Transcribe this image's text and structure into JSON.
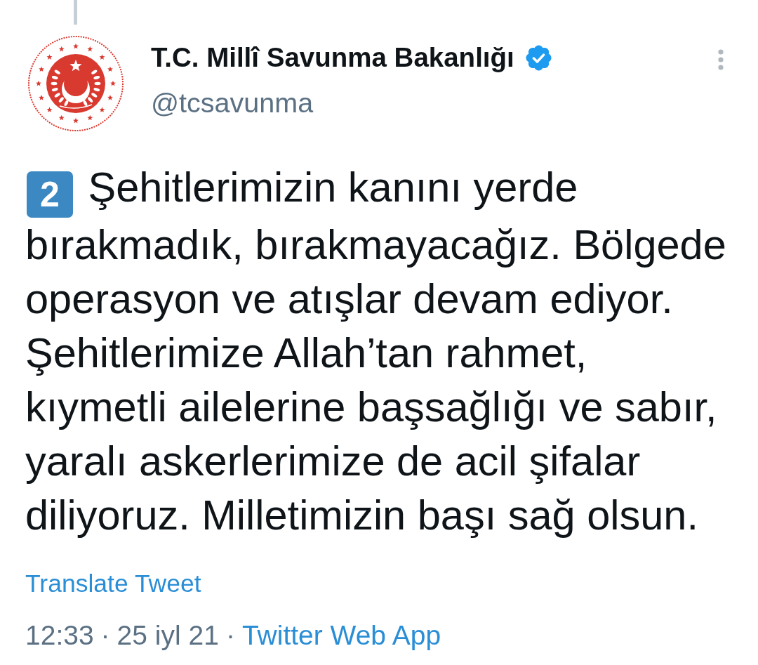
{
  "author": {
    "name": "T.C. Millî Savunma Bakanlığı",
    "verified": true,
    "handle": "@tcsavunma"
  },
  "tweet": {
    "number_emoji": "2",
    "text": "Şehitlerimizin kanını yerde bırakmadık, bırakmayacağız. Bölgede operasyon ve atışlar devam ediyor. Şehitlerimize Allah’tan rahmet, kıymetli ailelerine başsağlığı ve sabır, yaralı askerlerimize de acil şifalar diliyoruz. Milletimizin başı sağ olsun.",
    "translate_link": "Translate Tweet"
  },
  "meta": [
    {
      "kind": "time",
      "text": "12:33"
    },
    {
      "kind": "separator",
      "text": "·"
    },
    {
      "kind": "date",
      "text": "25 iyl 21"
    },
    {
      "kind": "separator",
      "text": "·"
    },
    {
      "kind": "source",
      "text": "Twitter Web App"
    }
  ]
}
